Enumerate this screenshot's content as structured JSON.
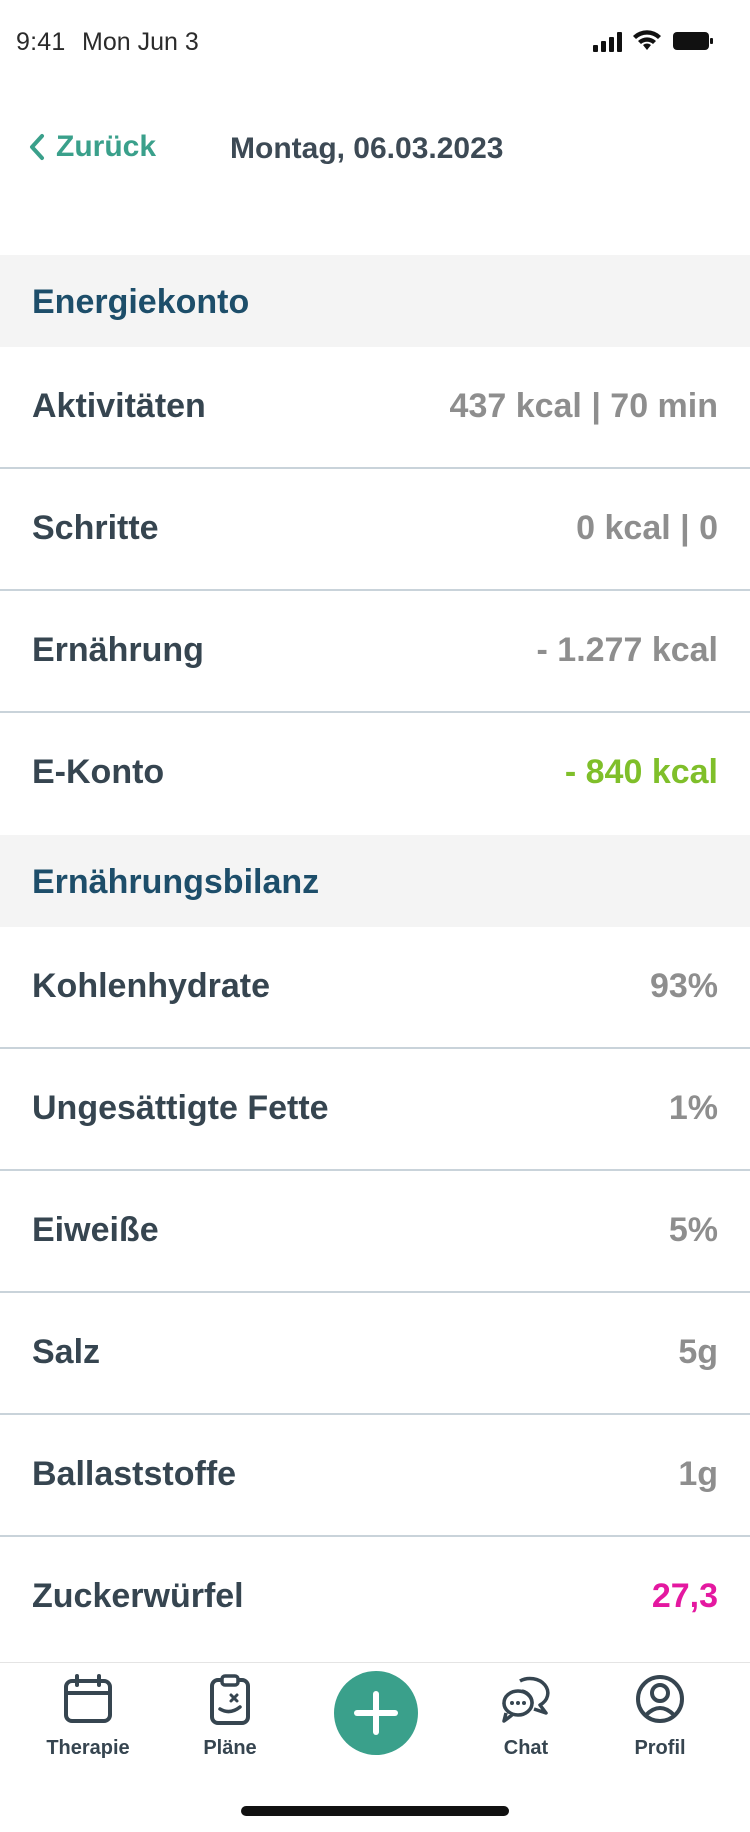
{
  "status_bar": {
    "time": "9:41",
    "date": "Mon Jun 3"
  },
  "header": {
    "back_label": "Zurück",
    "title": "Montag, 06.03.2023"
  },
  "energiekonto": {
    "title": "Energiekonto",
    "rows": [
      {
        "label": "Aktivitäten",
        "value": "437 kcal | 70 min"
      },
      {
        "label": "Schritte",
        "value": "0 kcal | 0"
      },
      {
        "label": "Ernährung",
        "value": "- 1.277 kcal"
      },
      {
        "label": "E-Konto",
        "value": "- 840 kcal",
        "value_color": "#7fbf2a"
      }
    ]
  },
  "ernaehrungsbilanz": {
    "title": "Ernährungsbilanz",
    "rows": [
      {
        "label": "Kohlenhydrate",
        "value": "93%"
      },
      {
        "label": "Ungesättigte Fette",
        "value": "1%"
      },
      {
        "label": "Eiweiße",
        "value": "5%"
      },
      {
        "label": "Salz",
        "value": "5g"
      },
      {
        "label": "Ballaststoffe",
        "value": "1g"
      },
      {
        "label": "Zuckerwürfel",
        "value": "27,3",
        "value_color": "#e418a0"
      }
    ]
  },
  "tab_bar": {
    "tabs": [
      {
        "label": "Therapie",
        "icon": "calendar-icon"
      },
      {
        "label": "Pläne",
        "icon": "clipboard-icon"
      },
      {
        "label": "",
        "icon": "plus-icon"
      },
      {
        "label": "Chat",
        "icon": "chat-icon"
      },
      {
        "label": "Profil",
        "icon": "profile-icon"
      }
    ]
  },
  "colors": {
    "accent": "#3aa08b",
    "section_title": "#1d4e6a",
    "positive": "#7fbf2a",
    "warning": "#e418a0"
  }
}
